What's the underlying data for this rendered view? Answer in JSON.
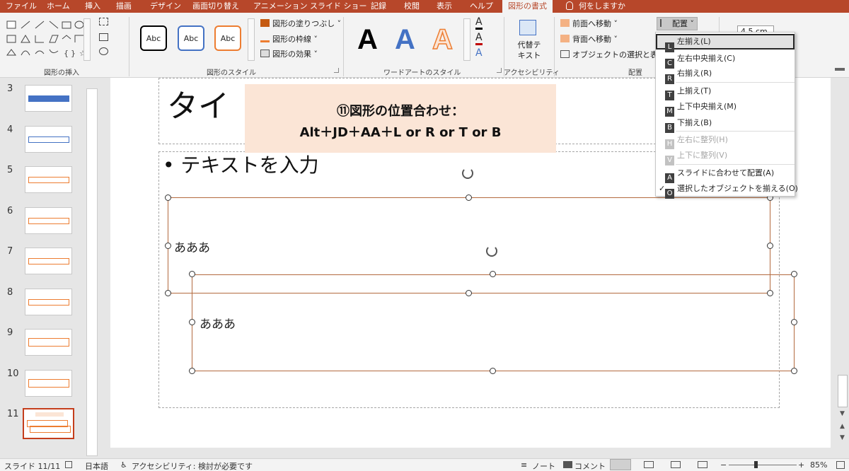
{
  "tabs": [
    "ファイル",
    "ホーム",
    "挿入",
    "描画",
    "デザイン",
    "画面切り替え",
    "アニメーション",
    "スライド ショー",
    "記録",
    "校閲",
    "表示",
    "ヘルプ",
    "図形の書式"
  ],
  "tell_me": "何をしますか",
  "ribbon": {
    "groups": {
      "insert_shapes": "図形の挿入",
      "shape_styles": "図形のスタイル",
      "wordart_styles": "ワードアートのスタイル",
      "accessibility": "アクセシビリティ",
      "arrange": "配置"
    },
    "style_box_label": "Abc",
    "wordart_letter": "A",
    "fill": "図形の塗りつぶし",
    "outline": "図形の枠線",
    "effects": "図形の効果",
    "alt_text": "代替テキスト",
    "alt_text_l1": "代替テ",
    "alt_text_l2": "キスト",
    "bring_forward": "前面へ移動",
    "send_backward": "背面へ移動",
    "selection_pane": "オブジェクトの選択と表示",
    "align": "配置",
    "height_value": "4.5 cm",
    "colors": {
      "fill_accent": "#c55a11",
      "outline_accent": "#ed7d31",
      "text_red": "#c00000"
    }
  },
  "thumbnails": [
    {
      "num": "3"
    },
    {
      "num": "4"
    },
    {
      "num": "5"
    },
    {
      "num": "6"
    },
    {
      "num": "7"
    },
    {
      "num": "8"
    },
    {
      "num": "9"
    },
    {
      "num": "10"
    },
    {
      "num": "11"
    }
  ],
  "slide": {
    "title_partial": "タイ",
    "bullet": "• テキストを入力",
    "shape1_text": "あああ",
    "shape2_text": "あああ"
  },
  "banner": {
    "line1": "⑪図形の位置合わせ：",
    "line2": "Alt＋JD＋AA＋L or R or T or B"
  },
  "align_menu": [
    {
      "label": "左揃え(L)",
      "key": "L",
      "disabled": false
    },
    {
      "label": "左右中央揃え(C)",
      "key": "C",
      "disabled": false
    },
    {
      "label": "右揃え(R)",
      "key": "R",
      "disabled": false
    },
    {
      "label": "上揃え(T)",
      "key": "T",
      "disabled": false
    },
    {
      "label": "上下中央揃え(M)",
      "key": "M",
      "disabled": false
    },
    {
      "label": "下揃え(B)",
      "key": "B",
      "disabled": false
    },
    {
      "label": "左右に整列(H)",
      "key": "H",
      "disabled": true
    },
    {
      "label": "上下に整列(V)",
      "key": "V",
      "disabled": true
    },
    {
      "label": "スライドに合わせて配置(A)",
      "key": "A",
      "disabled": false
    },
    {
      "label": "選択したオブジェクトを揃える(O)",
      "key": "O",
      "disabled": false
    }
  ],
  "status": {
    "slide": "スライド 11/11",
    "language": "日本語",
    "accessibility": "アクセシビリティ: 検討が必要です",
    "notes": "ノート",
    "comments": "コメント",
    "zoom": "85%"
  }
}
